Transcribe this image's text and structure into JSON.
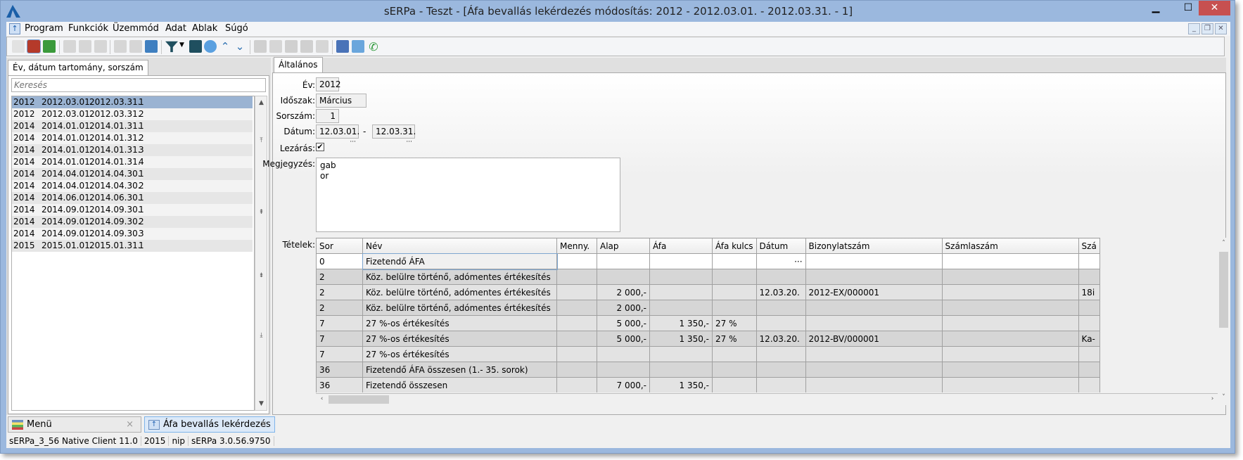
{
  "window": {
    "title": "sERPa - Teszt - [Áfa bevallás lekérdezés módosítás: 2012 - 2012.03.01. - 2012.03.31. - 1]",
    "minimize": "▁",
    "maximize": "☐",
    "close": "✕"
  },
  "menu": [
    "Program",
    "Funkciók",
    "Üzemmód",
    "Adat",
    "Ablak",
    "Súgó"
  ],
  "mdi_controls": {
    "minimize": "_",
    "restore": "❐",
    "close": "✕"
  },
  "left": {
    "tab": "Év, dátum tartomány, sorszám",
    "search_placeholder": "Keresés",
    "rows": [
      [
        "2012",
        "2012.03.01.",
        "2012.03.31.",
        "1"
      ],
      [
        "2012",
        "2012.03.01.",
        "2012.03.31.",
        "2"
      ],
      [
        "2014",
        "2014.01.01.",
        "2014.01.31.",
        "1"
      ],
      [
        "2014",
        "2014.01.01.",
        "2014.01.31.",
        "2"
      ],
      [
        "2014",
        "2014.01.01.",
        "2014.01.31.",
        "3"
      ],
      [
        "2014",
        "2014.01.01.",
        "2014.01.31.",
        "4"
      ],
      [
        "2014",
        "2014.04.01.",
        "2014.04.30.",
        "1"
      ],
      [
        "2014",
        "2014.04.01.",
        "2014.04.30.",
        "2"
      ],
      [
        "2014",
        "2014.06.01.",
        "2014.06.30.",
        "1"
      ],
      [
        "2014",
        "2014.09.01.",
        "2014.09.30.",
        "1"
      ],
      [
        "2014",
        "2014.09.01.",
        "2014.09.30.",
        "2"
      ],
      [
        "2014",
        "2014.09.01.",
        "2014.09.30.",
        "3"
      ],
      [
        "2015",
        "2015.01.01.",
        "2015.01.31.",
        "1"
      ]
    ],
    "selected_index": 0
  },
  "form": {
    "tab": "Általános",
    "ev_label": "Év:",
    "ev": "2012",
    "idoszak_label": "Időszak:",
    "idoszak": "Március",
    "sorszam_label": "Sorszám:",
    "sorszam": "1",
    "datum_label": "Dátum:",
    "datum_from": "12.03.01.",
    "datum_to": "12.03.31.",
    "datum_sep": "-",
    "ellipsis": "···",
    "lezaras_label": "Lezárás:",
    "lezaras_checked": true,
    "megjegyzes_label": "Megjegyzés:",
    "megjegyzes": "gab\nor",
    "tetelek_label": "Tételek:"
  },
  "table": {
    "columns": [
      "Sor",
      "Név",
      "Menny.",
      "Alap",
      "Áfa",
      "Áfa kulcs",
      "Dátum",
      "Bizonylatszám",
      "Számlaszám",
      "Szá"
    ],
    "rows": [
      [
        "0",
        "Fizetendő ÁFA",
        "",
        "",
        "",
        "",
        "···",
        "",
        "",
        ""
      ],
      [
        "2",
        "Köz. belülre történő, adómentes értékesítés",
        "",
        "",
        "",
        "",
        "",
        "",
        "",
        ""
      ],
      [
        "2",
        "Köz. belülre történő, adómentes értékesítés",
        "",
        "2 000,-",
        "",
        "",
        "12.03.20.",
        "2012-EX/000001",
        "",
        "18i"
      ],
      [
        "2",
        "Köz. belülre történő, adómentes értékesítés",
        "",
        "2 000,-",
        "",
        "",
        "",
        "",
        "",
        ""
      ],
      [
        "7",
        "27 %-os értékesítés",
        "",
        "5 000,-",
        "1 350,-",
        "27 %",
        "",
        "",
        "",
        ""
      ],
      [
        "7",
        "27 %-os értékesítés",
        "",
        "5 000,-",
        "1 350,-",
        "27 %",
        "12.03.20.",
        "2012-BV/000001",
        "",
        "Ka-"
      ],
      [
        "7",
        "27 %-os értékesítés",
        "",
        "",
        "",
        "",
        "",
        "",
        "",
        ""
      ],
      [
        "36",
        "Fizetendő ÁFA összesen (1.- 35. sorok)",
        "",
        "",
        "",
        "",
        "",
        "",
        "",
        ""
      ],
      [
        "36",
        "Fizetendő összesen",
        "",
        "7 000,-",
        "1 350,-",
        "",
        "",
        "",
        "",
        ""
      ]
    ]
  },
  "bottom_tabs": [
    {
      "label": "Menü",
      "close": "×"
    },
    {
      "label": "Áfa bevallás lekérdezés",
      "close": "×"
    }
  ],
  "status": [
    "sERPa_3_56 Native Client 11.0",
    "2015",
    "nip",
    "sERPa 3.0.56.9750"
  ],
  "colors": {
    "selection": "#9ab3d2",
    "titlebar": "#9bb8de",
    "close_button": "#c75050"
  }
}
